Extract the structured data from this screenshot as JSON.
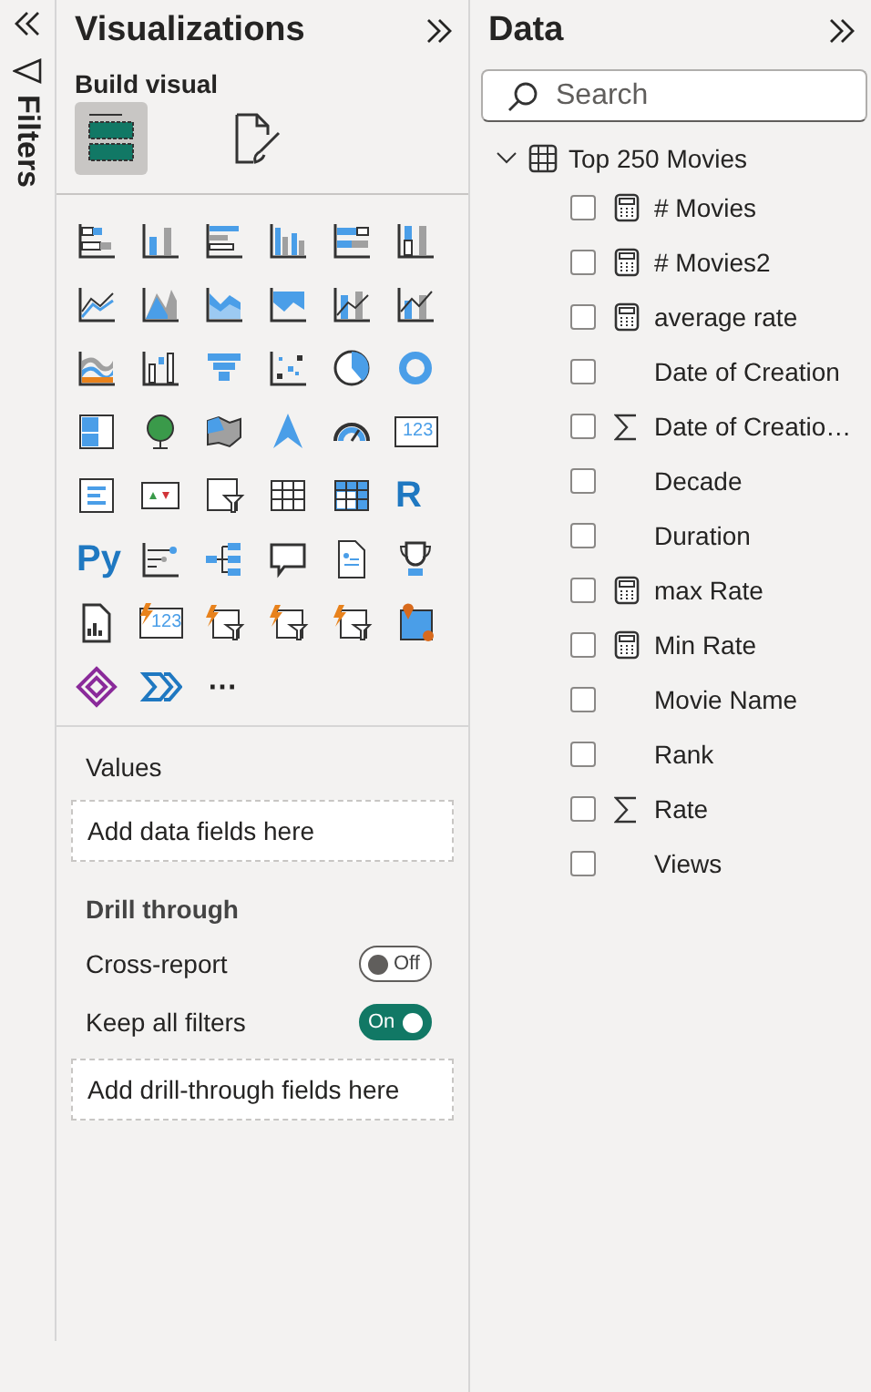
{
  "filters_pane": {
    "title": "Filters"
  },
  "visualizations": {
    "title": "Visualizations",
    "subtitle": "Build visual",
    "build_tabs": [
      {
        "kind": "fields",
        "selected": true
      },
      {
        "kind": "format",
        "selected": false
      }
    ],
    "visuals": [
      {
        "kind": "stacked-bar"
      },
      {
        "kind": "stacked-column"
      },
      {
        "kind": "clustered-bar"
      },
      {
        "kind": "clustered-column"
      },
      {
        "kind": "percent-bar"
      },
      {
        "kind": "percent-column"
      },
      {
        "kind": "line"
      },
      {
        "kind": "area"
      },
      {
        "kind": "stacked-area"
      },
      {
        "kind": "band-area"
      },
      {
        "kind": "line-column"
      },
      {
        "kind": "line-column-grey"
      },
      {
        "kind": "ribbon"
      },
      {
        "kind": "waterfall"
      },
      {
        "kind": "funnel"
      },
      {
        "kind": "scatter"
      },
      {
        "kind": "pie"
      },
      {
        "kind": "donut"
      },
      {
        "kind": "treemap"
      },
      {
        "kind": "globe"
      },
      {
        "kind": "filled-map"
      },
      {
        "kind": "arrow"
      },
      {
        "kind": "gauge"
      },
      {
        "kind": "card",
        "glyph": "123"
      },
      {
        "kind": "list-card"
      },
      {
        "kind": "kpi"
      },
      {
        "kind": "slicer"
      },
      {
        "kind": "table"
      },
      {
        "kind": "matrix"
      },
      {
        "kind": "letter",
        "glyph": "R"
      },
      {
        "kind": "letter",
        "glyph": "Py"
      },
      {
        "kind": "influencers"
      },
      {
        "kind": "tree"
      },
      {
        "kind": "bubble"
      },
      {
        "kind": "document"
      },
      {
        "kind": "trophy"
      },
      {
        "kind": "report"
      },
      {
        "kind": "bolt-card",
        "glyph": "123"
      },
      {
        "kind": "bolt-slicer"
      },
      {
        "kind": "bolt-text"
      },
      {
        "kind": "bolt-filter"
      },
      {
        "kind": "pin-map"
      },
      {
        "kind": "diamond"
      },
      {
        "kind": "chevrons"
      },
      {
        "kind": "more",
        "glyph": "⋯"
      }
    ],
    "sections": [
      {
        "kind": "well",
        "title": "Values",
        "placeholder": "Add data fields here"
      },
      {
        "kind": "heading",
        "title": "Drill through"
      },
      {
        "kind": "toggle",
        "title": "Cross-report",
        "on": false,
        "state": "Off"
      },
      {
        "kind": "toggle",
        "title": "Keep all filters",
        "on": true,
        "state": "On"
      },
      {
        "kind": "well",
        "placeholder": "Add drill-through fields here"
      }
    ]
  },
  "data": {
    "title": "Data",
    "search": {
      "placeholder": "Search"
    },
    "tables": [
      {
        "name": "Top 250 Movies",
        "expanded": true,
        "fields": [
          {
            "name": "# Movies",
            "kind": "measure",
            "checked": false
          },
          {
            "name": "# Movies2",
            "kind": "measure",
            "checked": false
          },
          {
            "name": "average rate",
            "kind": "measure",
            "checked": false
          },
          {
            "name": "Date of Creation",
            "kind": "plain",
            "checked": false
          },
          {
            "name": "Date of Creatio…",
            "kind": "sum",
            "checked": false
          },
          {
            "name": "Decade",
            "kind": "plain",
            "checked": false
          },
          {
            "name": "Duration",
            "kind": "plain",
            "checked": false
          },
          {
            "name": "max Rate",
            "kind": "measure",
            "checked": false
          },
          {
            "name": "Min Rate",
            "kind": "measure",
            "checked": false
          },
          {
            "name": "Movie Name",
            "kind": "plain",
            "checked": false
          },
          {
            "name": "Rank",
            "kind": "plain",
            "checked": false
          },
          {
            "name": "Rate",
            "kind": "sum",
            "checked": false
          },
          {
            "name": "Views",
            "kind": "plain",
            "checked": false
          }
        ]
      }
    ]
  }
}
